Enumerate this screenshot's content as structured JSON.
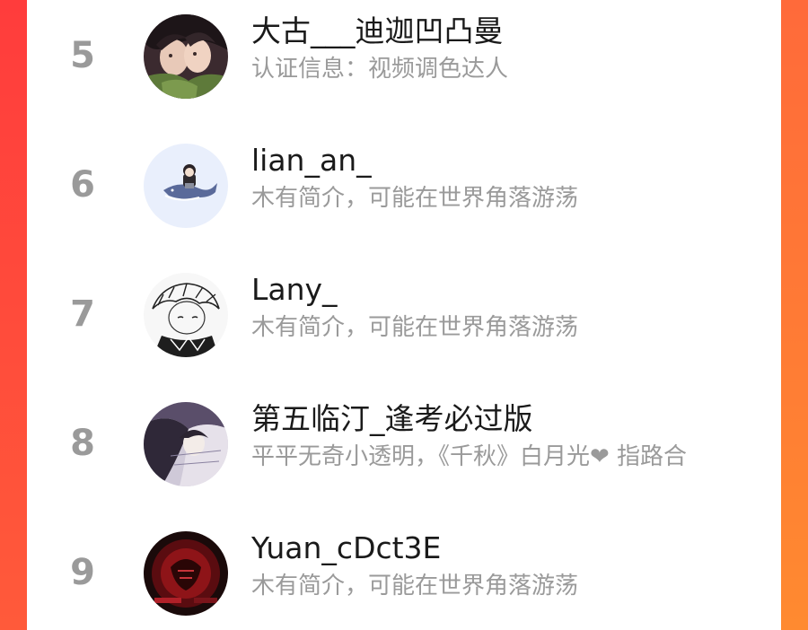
{
  "ranking": {
    "items": [
      {
        "rank": "5",
        "name": "大古___迪迦凹凸曼",
        "bio": "认证信息：视频调色达人",
        "avatar": "anime-couple-avatar"
      },
      {
        "rank": "6",
        "name": "lian_an_",
        "bio": "木有简介，可能在世界角落游荡",
        "avatar": "whale-rider-avatar"
      },
      {
        "rank": "7",
        "name": "Lany_",
        "bio": "木有简介，可能在世界角落游荡",
        "avatar": "sketch-character-avatar"
      },
      {
        "rank": "8",
        "name": "第五临汀_逢考必过版",
        "bio": "平平无奇小透明，《千秋》白月光❤ 指路合",
        "avatar": "ink-painting-avatar"
      },
      {
        "rank": "9",
        "name": "Yuan_cDct3E",
        "bio": "木有简介，可能在世界角落游荡",
        "avatar": "red-dark-avatar"
      }
    ]
  },
  "colors": {
    "rank": "#9a9a9a",
    "name": "#1a1a1a",
    "bio": "#9a9a9a",
    "background_accent": "#ff5a36"
  }
}
